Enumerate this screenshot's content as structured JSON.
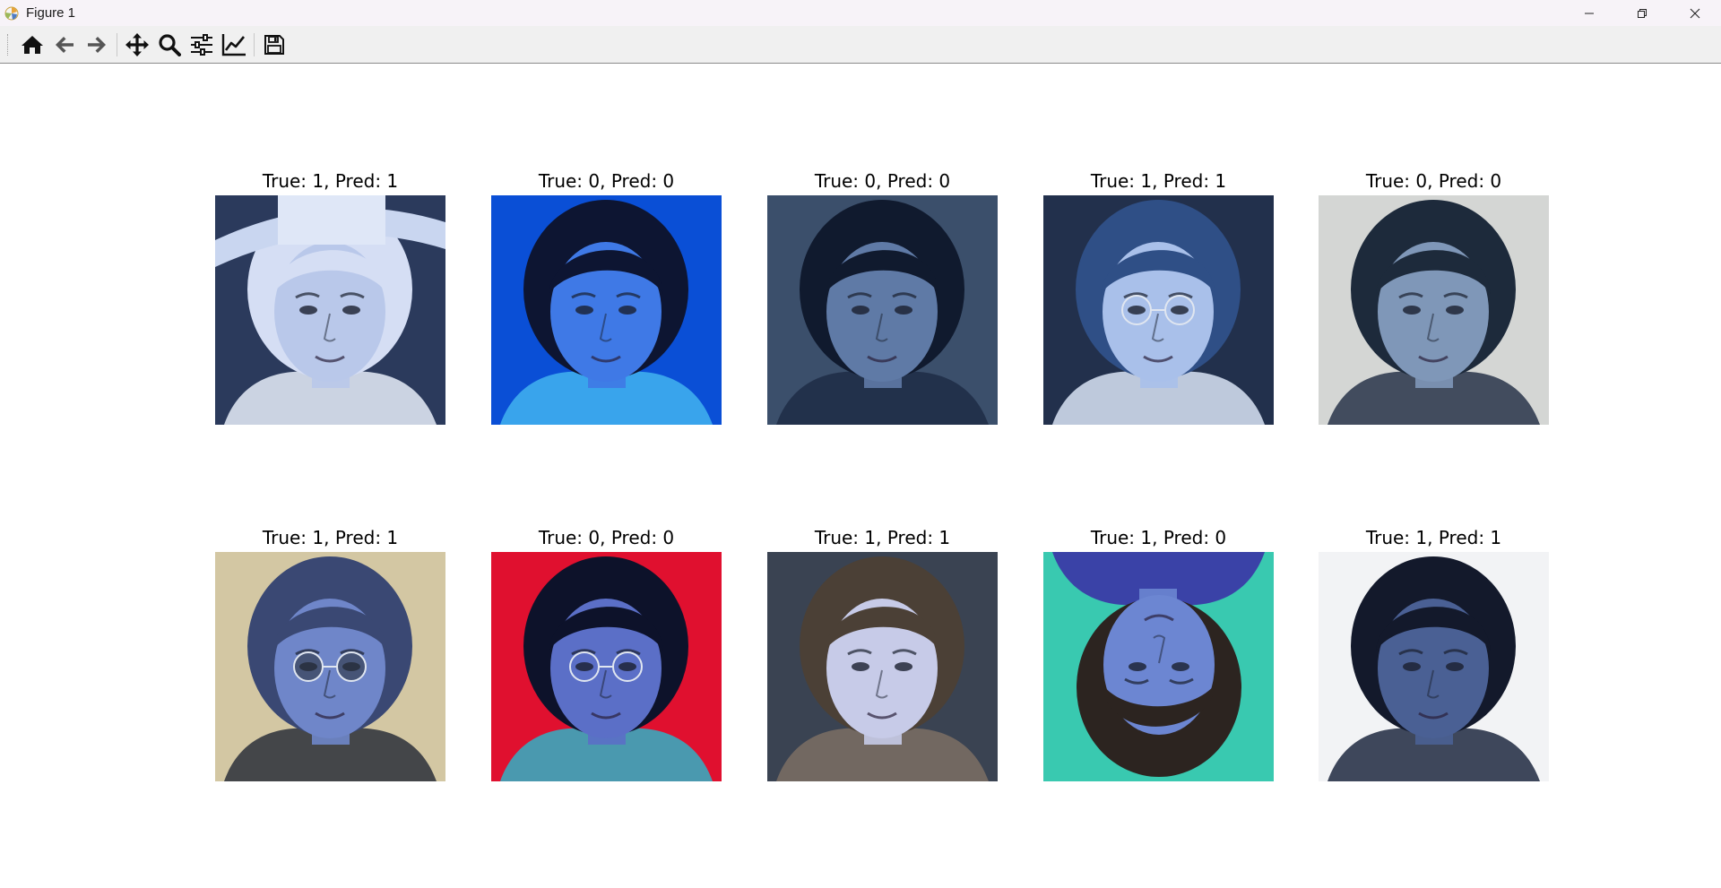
{
  "window": {
    "title": "Figure 1"
  },
  "toolbar": {
    "buttons": [
      {
        "name": "home-icon",
        "label": "Home"
      },
      {
        "name": "back-icon",
        "label": "Back"
      },
      {
        "name": "forward-icon",
        "label": "Forward"
      },
      {
        "name": "pan-icon",
        "label": "Pan"
      },
      {
        "name": "zoom-icon",
        "label": "Zoom"
      },
      {
        "name": "subplots-icon",
        "label": "Subplots"
      },
      {
        "name": "customize-icon",
        "label": "Customize"
      },
      {
        "name": "save-icon",
        "label": "Save"
      }
    ]
  },
  "subplots": [
    {
      "title": "True: 1, Pred: 1",
      "bg": "#2b3a5c",
      "skin": "#b9c8ea",
      "hair": "#d5def4",
      "accent": "#e8eef9"
    },
    {
      "title": "True: 0, Pred: 0",
      "bg": "#0a4fd6",
      "skin": "#3f79e6",
      "hair": "#0d1532",
      "accent": "#42b3f0"
    },
    {
      "title": "True: 0, Pred: 0",
      "bg": "#3b4f6b",
      "skin": "#5f7aa6",
      "hair": "#101a2e",
      "accent": "#1f2c45"
    },
    {
      "title": "True: 1, Pred: 1",
      "bg": "#22304c",
      "skin": "#a9c0ea",
      "hair": "#2f4f86",
      "accent": "#d9e4f6"
    },
    {
      "title": "True: 0, Pred: 0",
      "bg": "#d4d6d4",
      "skin": "#7f97b8",
      "hair": "#1d2a3b",
      "accent": "#283449"
    },
    {
      "title": "True: 1, Pred: 1",
      "bg": "#d3c7a3",
      "skin": "#6f86c9",
      "hair": "#3a4873",
      "accent": "#2a2f3a"
    },
    {
      "title": "True: 0, Pred: 0",
      "bg": "#e0102f",
      "skin": "#5b6fc7",
      "hair": "#0d122a",
      "accent": "#2fb2c5"
    },
    {
      "title": "True: 1, Pred: 1",
      "bg": "#3a4352",
      "skin": "#c7cbe8",
      "hair": "#4b4036",
      "accent": "#7c6f64"
    },
    {
      "title": "True: 1, Pred: 0",
      "bg": "#39c9b0",
      "skin": "#6c86d2",
      "hair": "#2c2420",
      "accent": "#3b2aa6"
    },
    {
      "title": "True: 1, Pred: 1",
      "bg": "#f2f3f5",
      "skin": "#4a6094",
      "hair": "#13192b",
      "accent": "#1f2840"
    }
  ]
}
